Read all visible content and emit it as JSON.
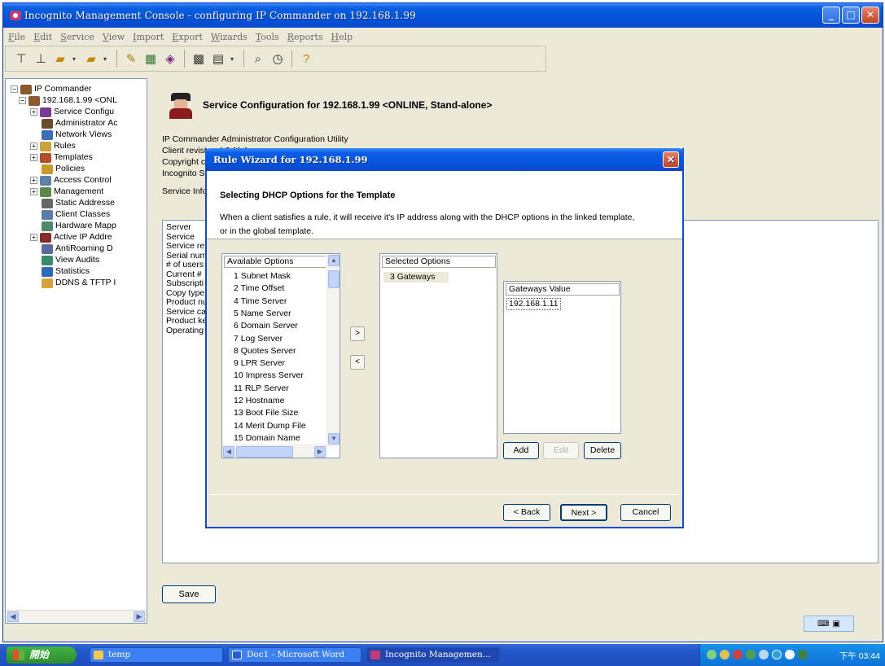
{
  "window": {
    "title": "Incognito Management Console - configuring IP Commander on 192.168.1.99",
    "controls": [
      "_",
      "□",
      "✕"
    ]
  },
  "menu": [
    "File",
    "Edit",
    "Service",
    "View",
    "Import",
    "Export",
    "Wizards",
    "Tools",
    "Reports",
    "Help"
  ],
  "toolbar_icons": [
    "filter-icon",
    "filter-alt-icon",
    "open-icon",
    "open-alt-icon",
    "edit-icon",
    "grid-icon",
    "search-doc-icon",
    "chart-icon",
    "document-icon",
    "zoom-icon",
    "clock-icon",
    "help-icon"
  ],
  "tree": {
    "items": [
      {
        "label": "IP Commander",
        "expander": "−",
        "icon": "server-icon"
      },
      {
        "label": "192.168.1.99 <ONL",
        "expander": "−",
        "icon": "server-icon"
      },
      {
        "label": "Service Configu",
        "expander": "+",
        "icon": "service-config-icon"
      },
      {
        "label": "Administrator Ac",
        "expander": "",
        "icon": "admin-icon"
      },
      {
        "label": "Network Views",
        "expander": "",
        "icon": "network-icon"
      },
      {
        "label": "Rules",
        "expander": "+",
        "icon": "rules-icon"
      },
      {
        "label": "Templates",
        "expander": "+",
        "icon": "templates-icon"
      },
      {
        "label": "Policies",
        "expander": "",
        "icon": "policies-icon"
      },
      {
        "label": "Access Control",
        "expander": "+",
        "icon": "lock-icon"
      },
      {
        "label": "Management",
        "expander": "+",
        "icon": "management-icon"
      },
      {
        "label": "Static Addresse",
        "expander": "",
        "icon": "static-icon"
      },
      {
        "label": "Client Classes",
        "expander": "",
        "icon": "classes-icon"
      },
      {
        "label": "Hardware Mapp",
        "expander": "",
        "icon": "hardware-icon"
      },
      {
        "label": "Active IP Addre",
        "expander": "+",
        "icon": "active-ip-icon"
      },
      {
        "label": "AntiRoaming D",
        "expander": "",
        "icon": "antiroaming-icon"
      },
      {
        "label": "View Audits",
        "expander": "",
        "icon": "audit-icon"
      },
      {
        "label": "Statistics",
        "expander": "",
        "icon": "statistics-icon"
      },
      {
        "label": "DDNS & TFTP I",
        "expander": "",
        "icon": "ddns-icon"
      }
    ]
  },
  "panel": {
    "heading": "Service Configuration for 192.168.1.99 <ONLINE, Stand-alone>",
    "info_lines": [
      "IP Commander Administrator Configuration Utility",
      "Client revision 4.3.11.1",
      "Copyright c",
      "Incognito S"
    ],
    "service_info_label": "Service Info",
    "box_labels": [
      "Server",
      "Service",
      "Service re",
      "Serial num",
      "# of users",
      "Current # ",
      "Subscripti",
      "Copy type",
      "Product nu",
      "Service ca",
      "Product ke",
      "Operating"
    ],
    "save_label": "Save"
  },
  "dialog": {
    "title": "Rule Wizard for 192.168.1.99",
    "heading": "Selecting DHCP Options for the Template",
    "description": "When a client satisfies a rule, it will receive it's IP address along with the DHCP options in the linked template, or in the global template.",
    "available": {
      "header": "Available Options",
      "items": [
        "1 Subnet Mask",
        "2 Time Offset",
        "4 Time Server",
        "5 Name Server",
        "6 Domain Server",
        "7 Log Server",
        "8 Quotes Server",
        "9 LPR Server",
        "10 Impress Server",
        "11 RLP Server",
        "12 Hostname",
        "13 Boot File Size",
        "14 Merit Dump File",
        "15 Domain Name"
      ]
    },
    "selected": {
      "header": "Selected Options",
      "items": [
        "3 Gateways"
      ]
    },
    "value_box": {
      "header": "Gateways Value",
      "value": "192.168.1.11"
    },
    "move_right": ">",
    "move_left": "<",
    "add_label": "Add",
    "edit_label": "Edit",
    "delete_label": "Delete",
    "back_label": "< Back",
    "next_label": "Next >",
    "cancel_label": "Cancel"
  },
  "taskbar": {
    "start_label": "開始",
    "tasks": [
      {
        "label": "temp",
        "active": false
      },
      {
        "label": "Doc1 - Microsoft Word",
        "active": false
      },
      {
        "label": "Incognito Managemen...",
        "active": true
      }
    ],
    "clock": "下午 03:44"
  },
  "colors": {
    "titlebar": "#0a5fe3",
    "dialog_border": "#0a4bd7",
    "close_button": "#c9431d",
    "taskbar": "#245dd7",
    "start_button": "#3a9f3a"
  }
}
